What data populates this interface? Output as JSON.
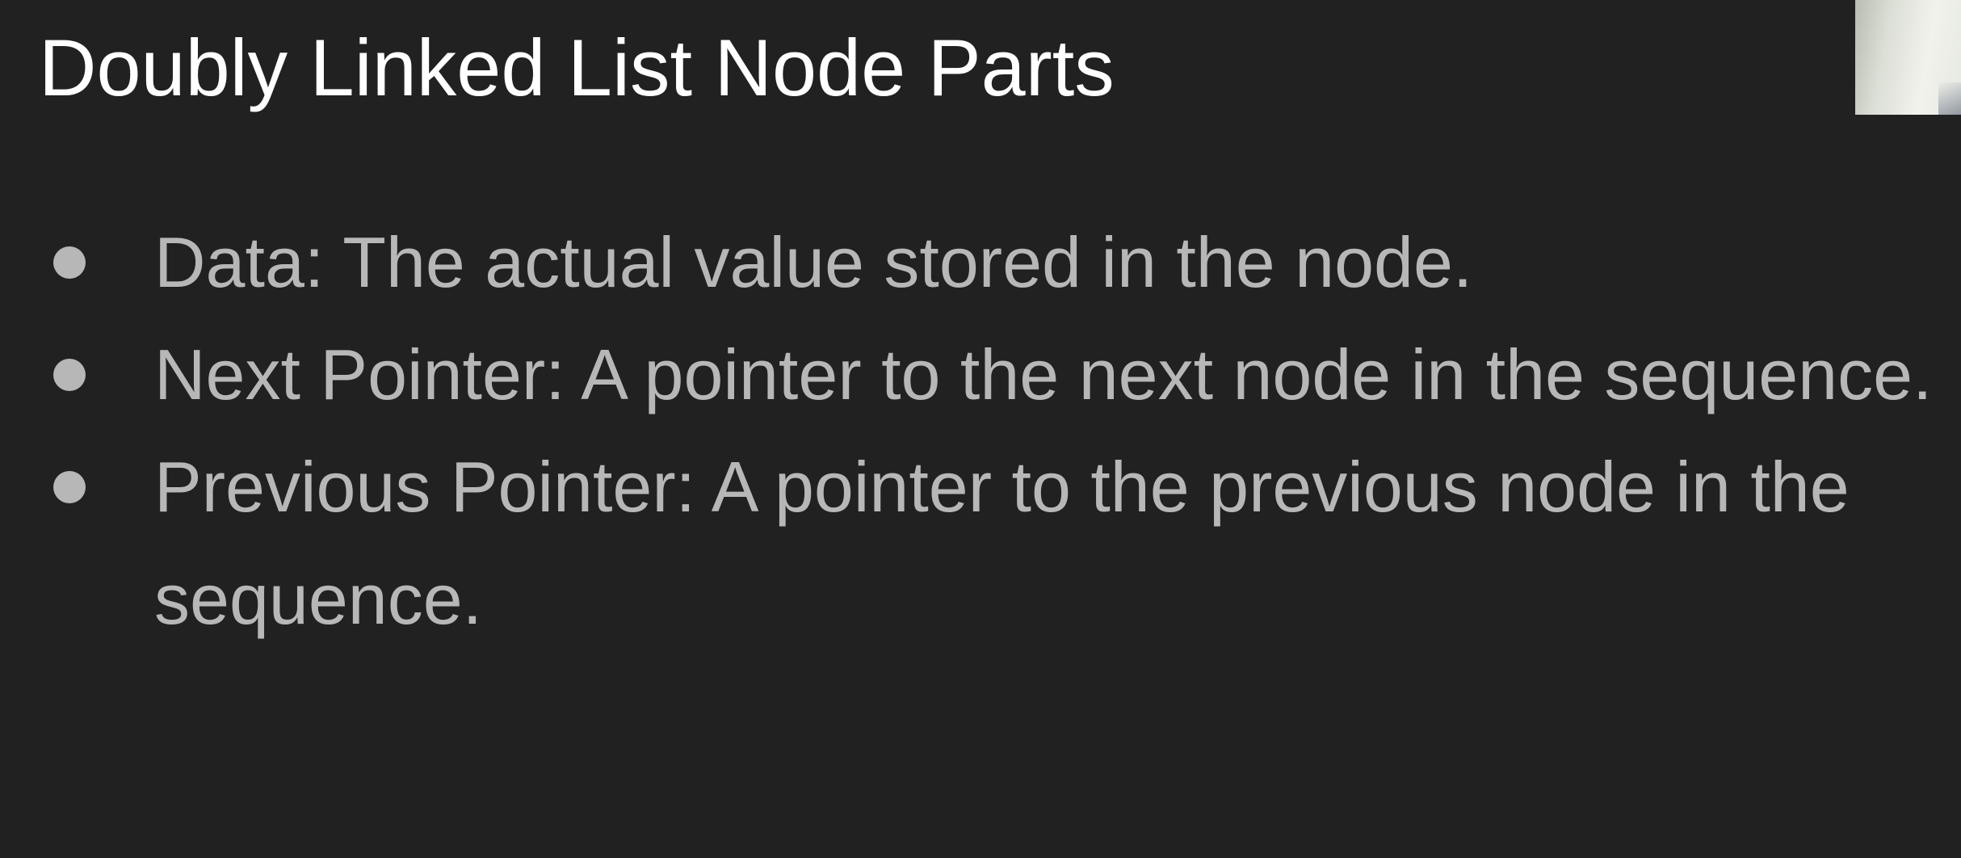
{
  "slide": {
    "title": "Doubly Linked List Node Parts",
    "bullets": [
      {
        "text": "Data: The actual value stored in the node."
      },
      {
        "text": "Next Pointer: A pointer to the next node in the sequence."
      },
      {
        "text": "Previous Pointer: A pointer to the previous node in the sequence."
      }
    ]
  },
  "colors": {
    "background": "#212121",
    "title": "#ffffff",
    "bullet_text": "#b7b7b7"
  }
}
